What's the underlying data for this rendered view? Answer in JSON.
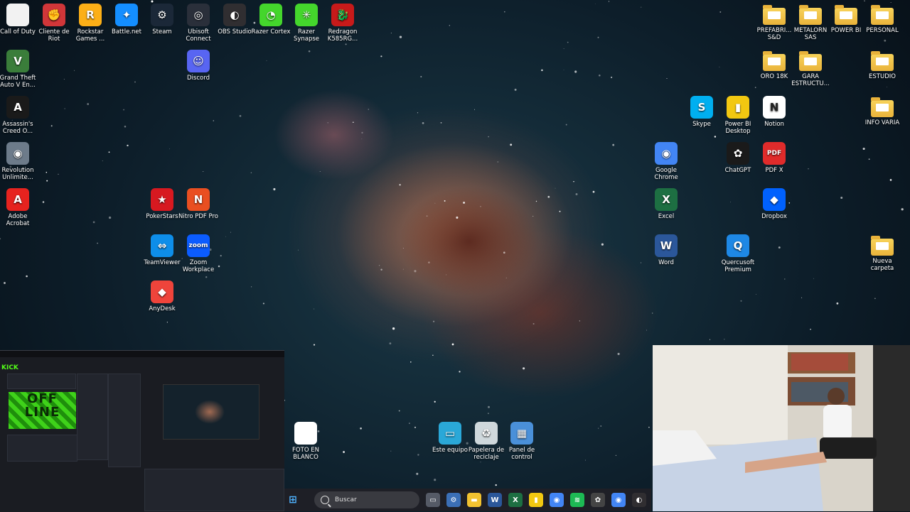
{
  "desktop_icons": [
    {
      "label": "Call of Duty",
      "icon": "call-of-duty-icon",
      "color": "#f2f2f2",
      "glyph": ""
    },
    {
      "label": "Cliente de Riot",
      "icon": "riot-client-icon",
      "color": "#d13639",
      "glyph": "✊"
    },
    {
      "label": "Rockstar Games ...",
      "icon": "rockstar-games-icon",
      "color": "#fcaf17",
      "glyph": "R"
    },
    {
      "label": "Battle.net",
      "icon": "battlenet-icon",
      "color": "#148eff",
      "glyph": "✦"
    },
    {
      "label": "Steam",
      "icon": "steam-icon",
      "color": "#1b2838",
      "glyph": "⚙"
    },
    {
      "label": "Ubisoft Connect",
      "icon": "ubisoft-connect-icon",
      "color": "#2a2f3a",
      "glyph": "◎"
    },
    {
      "label": "OBS Studio",
      "icon": "obs-studio-icon",
      "color": "#302e31",
      "glyph": "◐"
    },
    {
      "label": "Razer Cortex",
      "icon": "razer-cortex-icon",
      "color": "#44d62c",
      "glyph": "◔"
    },
    {
      "label": "Razer Synapse",
      "icon": "razer-synapse-icon",
      "color": "#44d62c",
      "glyph": "✳"
    },
    {
      "label": "Redragon K585RG...",
      "icon": "redragon-icon",
      "color": "#c71a1a",
      "glyph": "🐉"
    },
    {
      "label": "Discord",
      "icon": "discord-icon",
      "color": "#5865f2",
      "glyph": "☺"
    },
    {
      "label": "Grand Theft Auto V En...",
      "icon": "gta-v-icon",
      "color": "#3a7d3a",
      "glyph": "V"
    },
    {
      "label": "Assassin's Creed O...",
      "icon": "assassins-creed-icon",
      "color": "#1a1a1a",
      "glyph": "A"
    },
    {
      "label": "Revolution Unlimite...",
      "icon": "revolution-unlimited-icon",
      "color": "#6d7b8a",
      "glyph": "◉"
    },
    {
      "label": "Adobe Acrobat",
      "icon": "adobe-acrobat-icon",
      "color": "#e6231f",
      "glyph": "A"
    },
    {
      "label": "PokerStars",
      "icon": "pokerstars-icon",
      "color": "#d71920",
      "glyph": "★"
    },
    {
      "label": "Nitro PDF Pro",
      "icon": "nitro-pdf-icon",
      "color": "#e94f21",
      "glyph": "N"
    },
    {
      "label": "TeamViewer",
      "icon": "teamviewer-icon",
      "color": "#0e8ee9",
      "glyph": "⇔"
    },
    {
      "label": "Zoom Workplace",
      "icon": "zoom-icon",
      "color": "#0b5cff",
      "glyph": "zoom"
    },
    {
      "label": "AnyDesk",
      "icon": "anydesk-icon",
      "color": "#ef443b",
      "glyph": "◆"
    },
    {
      "label": "PREFABRI... S&D",
      "icon": "folder-icon",
      "color": "folder",
      "glyph": ""
    },
    {
      "label": "METALORN SAS",
      "icon": "folder-icon",
      "color": "folder",
      "glyph": ""
    },
    {
      "label": "POWER BI",
      "icon": "folder-icon",
      "color": "folder",
      "glyph": ""
    },
    {
      "label": "PERSONAL",
      "icon": "folder-icon",
      "color": "folder",
      "glyph": ""
    },
    {
      "label": "ORO 18K",
      "icon": "folder-icon",
      "color": "folder",
      "glyph": ""
    },
    {
      "label": "GARA ESTRUCTU...",
      "icon": "folder-icon",
      "color": "folder",
      "glyph": ""
    },
    {
      "label": "ESTUDIO",
      "icon": "folder-icon",
      "color": "folder",
      "glyph": ""
    },
    {
      "label": "Skype",
      "icon": "skype-icon",
      "color": "#00aff0",
      "glyph": "S"
    },
    {
      "label": "Power BI Desktop",
      "icon": "power-bi-icon",
      "color": "#f2c811",
      "glyph": "▮"
    },
    {
      "label": "Notion",
      "icon": "notion-icon",
      "color": "#ffffff",
      "glyph": "N"
    },
    {
      "label": "INFO VARIA",
      "icon": "folder-icon",
      "color": "folder",
      "glyph": ""
    },
    {
      "label": "Google Chrome",
      "icon": "chrome-icon",
      "color": "#4285f4",
      "glyph": "◉"
    },
    {
      "label": "ChatGPT",
      "icon": "chatgpt-icon",
      "color": "#1a1a1a",
      "glyph": "✿"
    },
    {
      "label": "PDF X",
      "icon": "pdf-x-icon",
      "color": "#e02b2b",
      "glyph": "PDF"
    },
    {
      "label": "Excel",
      "icon": "excel-icon",
      "color": "#1d6f42",
      "glyph": "X"
    },
    {
      "label": "Dropbox",
      "icon": "dropbox-icon",
      "color": "#0061fe",
      "glyph": "◆"
    },
    {
      "label": "Word",
      "icon": "word-icon",
      "color": "#2b579a",
      "glyph": "W"
    },
    {
      "label": "Quercusoft Premium",
      "icon": "quercusoft-icon",
      "color": "#1e88e5",
      "glyph": "Q"
    },
    {
      "label": "Nueva carpeta",
      "icon": "folder-icon",
      "color": "folder",
      "glyph": ""
    },
    {
      "label": "FOTO EN BLANCO",
      "icon": "blank-image-icon",
      "color": "#ffffff",
      "glyph": ""
    },
    {
      "label": "Este equipo",
      "icon": "this-pc-icon",
      "color": "#2aa8d8",
      "glyph": "▭"
    },
    {
      "label": "Papelera de reciclaje",
      "icon": "recycle-bin-icon",
      "color": "#cfd8dc",
      "glyph": "♻"
    },
    {
      "label": "Panel de control",
      "icon": "control-panel-icon",
      "color": "#4a90d9",
      "glyph": "▦"
    }
  ],
  "taskbar": {
    "search_placeholder": "Buscar",
    "apps": [
      {
        "icon": "task-view-icon",
        "color": "#555a66",
        "glyph": "▭"
      },
      {
        "icon": "settings-icon",
        "color": "#3b6fb6",
        "glyph": "⚙"
      },
      {
        "icon": "file-explorer-icon",
        "color": "#f2c230",
        "glyph": "▬"
      },
      {
        "icon": "word-icon",
        "color": "#2b579a",
        "glyph": "W"
      },
      {
        "icon": "excel-icon",
        "color": "#1d6f42",
        "glyph": "X"
      },
      {
        "icon": "power-bi-icon",
        "color": "#f2c811",
        "glyph": "▮"
      },
      {
        "icon": "chrome-icon",
        "color": "#4285f4",
        "glyph": "◉"
      },
      {
        "icon": "spotify-icon",
        "color": "#1db954",
        "glyph": "≋"
      },
      {
        "icon": "chatgpt-icon",
        "color": "#444",
        "glyph": "✿"
      },
      {
        "icon": "chrome-profile-icon",
        "color": "#4285f4",
        "glyph": "◉"
      },
      {
        "icon": "obs-studio-icon",
        "color": "#302e31",
        "glyph": "◐"
      }
    ]
  },
  "obs_window": {
    "brand": "KICK",
    "offline_text": "OFF LINE"
  }
}
